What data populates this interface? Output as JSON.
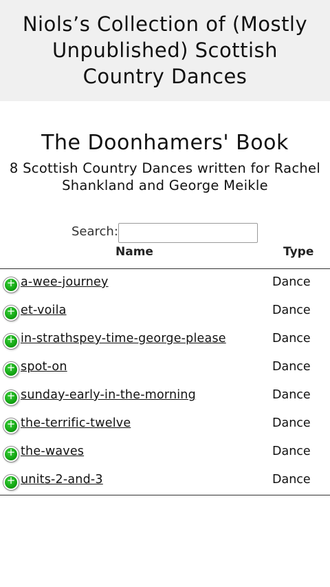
{
  "site": {
    "title": "Niols’s Collection of (Mostly Unpublished) Scottish Country Dances"
  },
  "book": {
    "title": "The Doonhamers' Book",
    "subtitle": "8 Scottish Country Dances written for Rachel Shankland and George Meikle"
  },
  "search": {
    "label": "Search:",
    "value": "",
    "placeholder": ""
  },
  "table": {
    "headers": {
      "name": "Name",
      "type": "Type"
    },
    "expand_icon": "plus-circle-icon",
    "expand_color": "#1aa81a",
    "rows": [
      {
        "name": "a-wee-journey",
        "type": "Dance"
      },
      {
        "name": "et-voila",
        "type": "Dance"
      },
      {
        "name": "in-strathspey-time-george-please",
        "type": "Dance"
      },
      {
        "name": "spot-on",
        "type": "Dance"
      },
      {
        "name": "sunday-early-in-the-morning",
        "type": "Dance"
      },
      {
        "name": "the-terrific-twelve",
        "type": "Dance"
      },
      {
        "name": "the-waves",
        "type": "Dance"
      },
      {
        "name": "units-2-and-3",
        "type": "Dance"
      }
    ]
  }
}
